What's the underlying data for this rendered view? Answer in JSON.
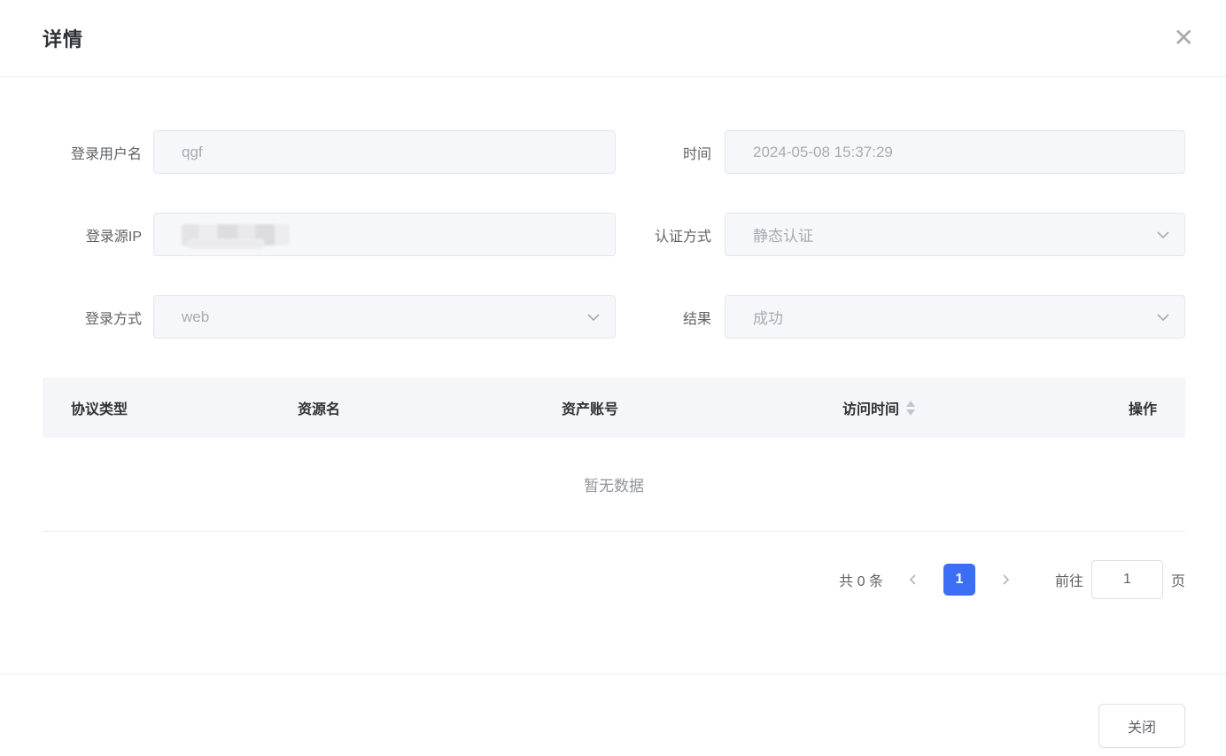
{
  "dialog": {
    "title": "详情",
    "close_icon": "close-x"
  },
  "form": {
    "fields": [
      {
        "label": "登录用户名",
        "value": "qgf",
        "type": "input"
      },
      {
        "label": "时间",
        "value": "2024-05-08 15:37:29",
        "type": "input"
      },
      {
        "label": "登录源IP",
        "value": "",
        "masked": true,
        "type": "input"
      },
      {
        "label": "认证方式",
        "value": "静态认证",
        "type": "select"
      },
      {
        "label": "登录方式",
        "value": "web",
        "type": "select"
      },
      {
        "label": "结果",
        "value": "成功",
        "type": "select"
      }
    ]
  },
  "table": {
    "columns": [
      "协议类型",
      "资源名",
      "资产账号",
      "访问时间",
      "操作"
    ],
    "sortable_column": "访问时间",
    "empty_text": "暂无数据"
  },
  "pagination": {
    "total_text": "共 0 条",
    "current_page": "1",
    "jump_prefix": "前往",
    "jump_value": "1",
    "jump_suffix": "页"
  },
  "footer": {
    "close_label": "关闭"
  },
  "colors": {
    "accent": "#3b6ef4",
    "input_bg": "#f5f7fa",
    "input_border": "#e4e7ed",
    "divider": "#e9ebf2",
    "label_text": "#606266",
    "value_text": "#a8abb2",
    "header_text": "#303133",
    "empty_text": "#909399",
    "sort_caret": "#c0c4cc"
  }
}
